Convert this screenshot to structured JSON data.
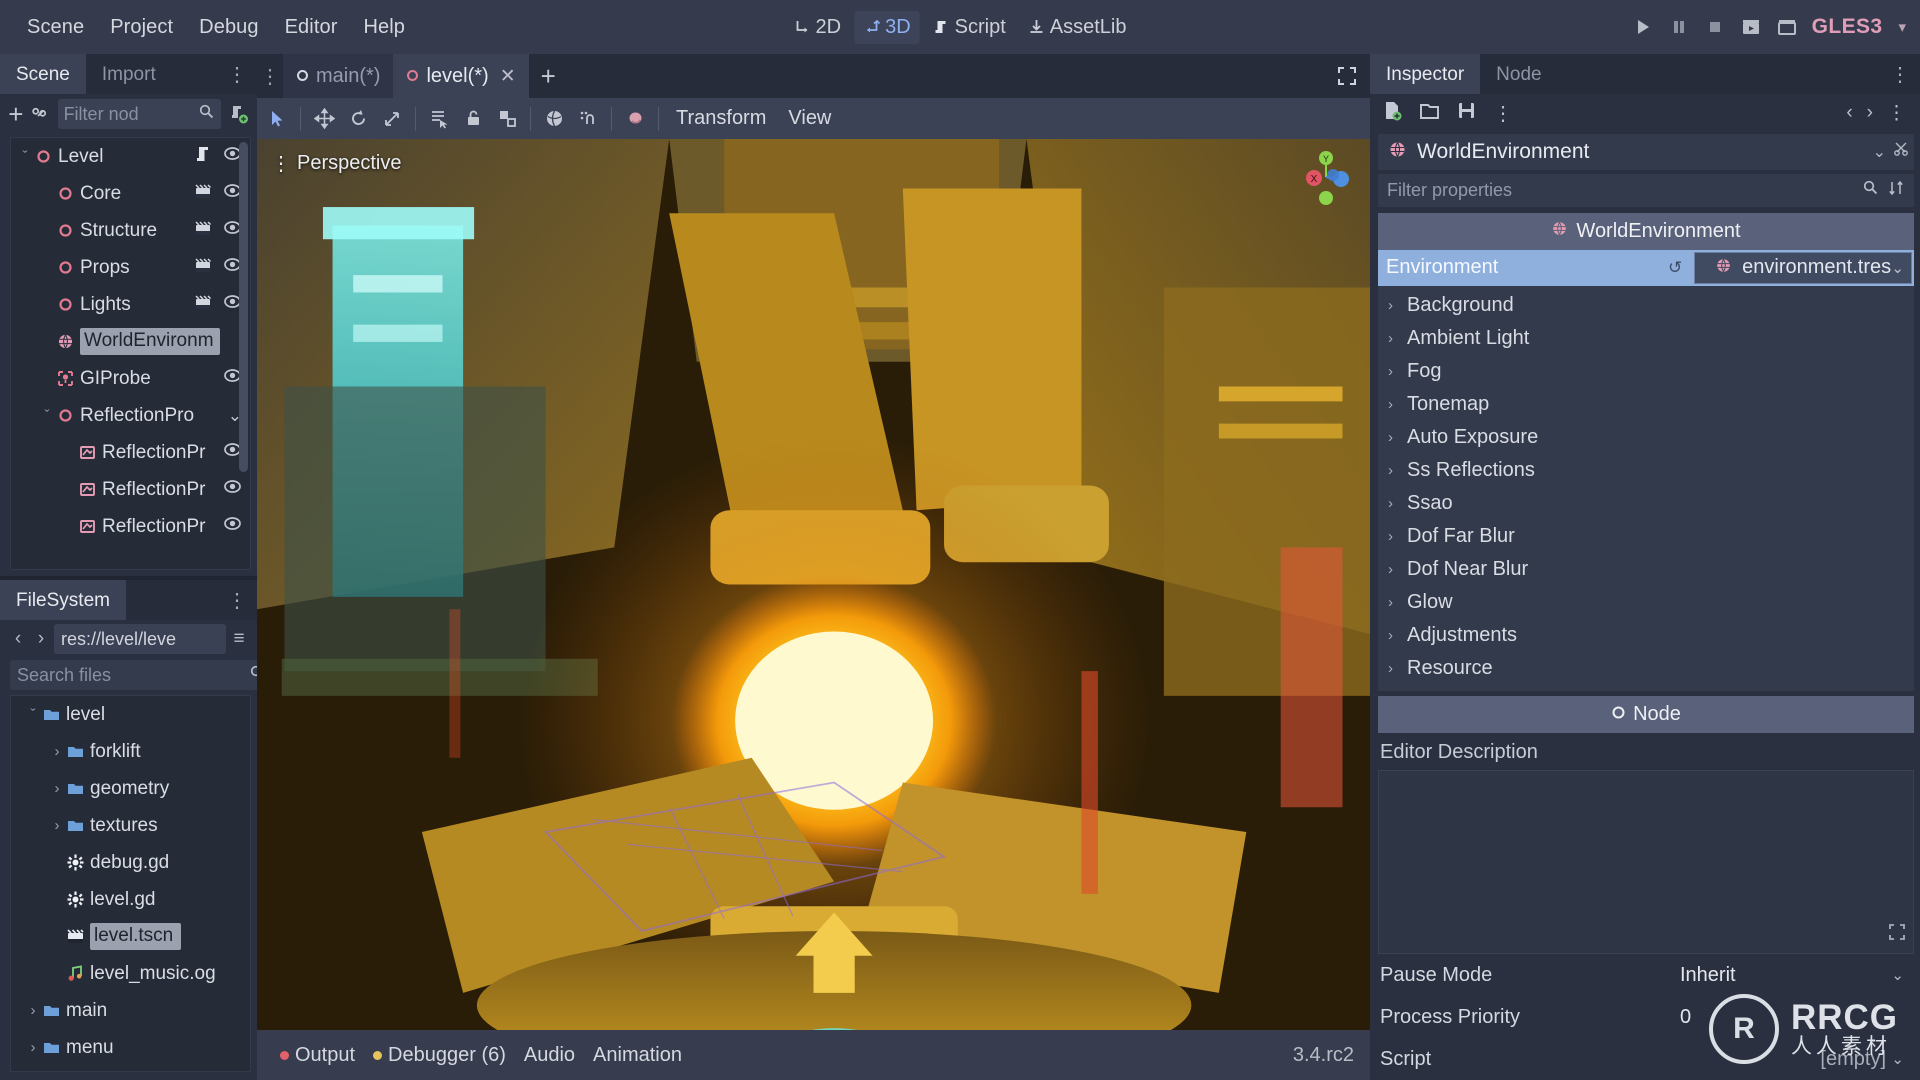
{
  "menu": {
    "items": [
      "Scene",
      "Project",
      "Debug",
      "Editor",
      "Help"
    ],
    "modes": [
      {
        "label": "2D",
        "icon": "move-2d-icon",
        "active": false
      },
      {
        "label": "3D",
        "icon": "move-3d-icon",
        "active": true
      },
      {
        "label": "Script",
        "icon": "script-icon",
        "active": false
      },
      {
        "label": "AssetLib",
        "icon": "assetlib-icon",
        "active": false
      }
    ],
    "playback": [
      {
        "name": "play-button",
        "glyph": "▶"
      },
      {
        "name": "pause-button",
        "glyph": "⏸"
      },
      {
        "name": "stop-button",
        "glyph": "■"
      },
      {
        "name": "play-scene-button",
        "glyph": "🎬"
      },
      {
        "name": "play-custom-scene-button",
        "glyph": "🎬"
      }
    ],
    "renderer": "GLES3"
  },
  "scene_dock": {
    "tabs": [
      {
        "label": "Scene",
        "active": true
      },
      {
        "label": "Import",
        "active": false
      }
    ],
    "menu_glyph": "⋮",
    "toolbar": {
      "add_node_glyph": "+",
      "instance_glyph": "🔗",
      "filter_placeholder": "Filter nod",
      "search_glyph": "⌕",
      "create_script_glyph": "📜"
    },
    "tree": [
      {
        "label": "Level",
        "depth": 0,
        "twisty": "ˇ",
        "icon": "node3d-icon",
        "selected": false,
        "script": true,
        "visible": true
      },
      {
        "label": "Core",
        "depth": 1,
        "twisty": "",
        "icon": "node3d-icon",
        "selected": false,
        "scene": true,
        "visible": true
      },
      {
        "label": "Structure",
        "depth": 1,
        "twisty": "",
        "icon": "node3d-icon",
        "selected": false,
        "scene": true,
        "visible": true
      },
      {
        "label": "Props",
        "depth": 1,
        "twisty": "",
        "icon": "node3d-icon",
        "selected": false,
        "scene": true,
        "visible": true
      },
      {
        "label": "Lights",
        "depth": 1,
        "twisty": "",
        "icon": "node3d-icon",
        "selected": false,
        "scene": true,
        "visible": true
      },
      {
        "label": "WorldEnvironm",
        "depth": 1,
        "twisty": "",
        "icon": "worldenvironment-icon",
        "selected": true,
        "scene": false,
        "visible": false
      },
      {
        "label": "GIProbe",
        "depth": 1,
        "twisty": "",
        "icon": "giprobe-icon",
        "selected": false,
        "scene": false,
        "visible": true
      },
      {
        "label": "ReflectionPro",
        "depth": 1,
        "twisty": "ˇ",
        "icon": "node3d-icon",
        "selected": false,
        "scene": false,
        "visible": false,
        "collapse_chev": true
      },
      {
        "label": "ReflectionPr",
        "depth": 2,
        "twisty": "",
        "icon": "reflectionprobe-icon",
        "selected": false,
        "scene": false,
        "visible": true
      },
      {
        "label": "ReflectionPr",
        "depth": 2,
        "twisty": "",
        "icon": "reflectionprobe-icon",
        "selected": false,
        "scene": false,
        "visible": true
      },
      {
        "label": "ReflectionPr",
        "depth": 2,
        "twisty": "",
        "icon": "reflectionprobe-icon",
        "selected": false,
        "scene": false,
        "visible": true
      }
    ]
  },
  "filesystem_dock": {
    "tab_label": "FileSystem",
    "menu_glyph": "⋮",
    "back_glyph": "‹",
    "forward_glyph": "›",
    "path": "res://level/leve",
    "path_menu_glyph": "≡",
    "search_placeholder": "Search files",
    "search_glyph": "⌕",
    "sort_glyph": "↓↑",
    "tree": [
      {
        "label": "level",
        "depth": 0,
        "twisty": "ˇ",
        "icon": "folder-icon",
        "selected": false
      },
      {
        "label": "forklift",
        "depth": 1,
        "twisty": "›",
        "icon": "folder-icon",
        "selected": false
      },
      {
        "label": "geometry",
        "depth": 1,
        "twisty": "›",
        "icon": "folder-icon",
        "selected": false
      },
      {
        "label": "textures",
        "depth": 1,
        "twisty": "›",
        "icon": "folder-icon",
        "selected": false
      },
      {
        "label": "debug.gd",
        "depth": 1,
        "twisty": "",
        "icon": "gdscript-icon",
        "selected": false
      },
      {
        "label": "level.gd",
        "depth": 1,
        "twisty": "",
        "icon": "gdscript-icon",
        "selected": false
      },
      {
        "label": "level.tscn",
        "depth": 1,
        "twisty": "",
        "icon": "packedscene-icon",
        "selected": true
      },
      {
        "label": "level_music.og",
        "depth": 1,
        "twisty": "",
        "icon": "audiostream-icon",
        "selected": false
      },
      {
        "label": "main",
        "depth": 0,
        "twisty": "›",
        "icon": "folder-icon",
        "selected": false
      },
      {
        "label": "menu",
        "depth": 0,
        "twisty": "›",
        "icon": "folder-icon",
        "selected": false
      }
    ]
  },
  "scene_tabs": {
    "dots_glyph": "⋮",
    "tabs": [
      {
        "label": "main(*)",
        "active": false,
        "closable": false
      },
      {
        "label": "level(*)",
        "active": true,
        "closable": true
      }
    ],
    "close_glyph": "✕",
    "add_glyph": "+"
  },
  "viewport_toolbar": {
    "tools": [
      {
        "name": "select-mode-tool",
        "glyph": "➤",
        "active": true
      },
      {
        "name": "move-mode-tool",
        "glyph": "✥",
        "active": false
      },
      {
        "name": "rotate-mode-tool",
        "glyph": "↻",
        "active": false
      },
      {
        "name": "scale-mode-tool",
        "glyph": "⤡",
        "active": false
      },
      {
        "name": "list-select-tool",
        "glyph": "☰",
        "active": false
      },
      {
        "name": "lock-selected-tool",
        "glyph": "🔒",
        "active": false
      },
      {
        "name": "group-selected-tool",
        "glyph": "⧉",
        "active": false
      },
      {
        "name": "local-space-tool",
        "glyph": "⬢",
        "active": false
      },
      {
        "name": "snap-mode-tool",
        "glyph": "⋰",
        "active": false
      },
      {
        "name": "camera-preview-tool",
        "glyph": "◑",
        "active": false
      }
    ],
    "menus": [
      "Transform",
      "View"
    ],
    "expand_glyph": "⤡"
  },
  "viewport": {
    "perspective_label": "Perspective",
    "perspective_menu_glyph": "⋮",
    "gizmo_axes": [
      {
        "label": "X",
        "color": "#fc7f7f"
      },
      {
        "label": "Y",
        "color": "#8bd44b"
      },
      {
        "label": "Z",
        "color": "#4f8fe0"
      }
    ]
  },
  "bottom_panel": {
    "tabs": [
      {
        "label": "Output",
        "dot": "#e2616a"
      },
      {
        "label": "Debugger (6)",
        "dot": "#e5c45c"
      },
      {
        "label": "Audio",
        "dot": ""
      },
      {
        "label": "Animation",
        "dot": ""
      }
    ],
    "version": "3.4.rc2"
  },
  "inspector": {
    "tabs": [
      {
        "label": "Inspector",
        "active": true
      },
      {
        "label": "Node",
        "active": false
      }
    ],
    "menu_glyph": "⋮",
    "toolbar": [
      {
        "name": "new-resource-button",
        "glyph": "📄"
      },
      {
        "name": "load-resource-button",
        "glyph": "📁"
      },
      {
        "name": "save-resource-button",
        "glyph": "💾"
      },
      {
        "name": "inspector-extra-menu-button",
        "glyph": "⋮"
      }
    ],
    "history_prev_glyph": "‹",
    "history_next_glyph": "›",
    "history_menu_glyph": "⋮",
    "node_name": "WorldEnvironment",
    "node_chevron": "⌄",
    "node_tool_glyph": "✂",
    "filter_placeholder": "Filter properties",
    "filter_search_glyph": "⌕",
    "filter_tool_glyph": "⇅",
    "category_label": "WorldEnvironment",
    "environment_property": {
      "name": "Environment",
      "revert_glyph": "↺",
      "value": "environment.tres",
      "caret": "⌄"
    },
    "sub_properties": [
      "Background",
      "Ambient Light",
      "Fog",
      "Tonemap",
      "Auto Exposure",
      "Ss Reflections",
      "Ssao",
      "Dof Far Blur",
      "Dof Near Blur",
      "Glow",
      "Adjustments",
      "Resource"
    ],
    "sub_arrow": "›",
    "node_section_label": "Node",
    "editor_description_label": "Editor Description",
    "description_resize_glyph": "⤡",
    "properties": [
      {
        "name": "Pause Mode",
        "value": "Inherit",
        "caret": "⌄"
      },
      {
        "name": "Process Priority",
        "value": "0",
        "caret": ""
      },
      {
        "name": "Script",
        "value": "[empty]",
        "caret": "⌄"
      }
    ]
  },
  "watermark": {
    "mark": "R",
    "main": "RRCG",
    "sub": "人人素材"
  },
  "colors": {
    "accent": "#8fafdd",
    "panel": "#2b3040",
    "menubar": "#353b4c",
    "node_red": "#e princess",
    "gles": "#e09db8"
  }
}
